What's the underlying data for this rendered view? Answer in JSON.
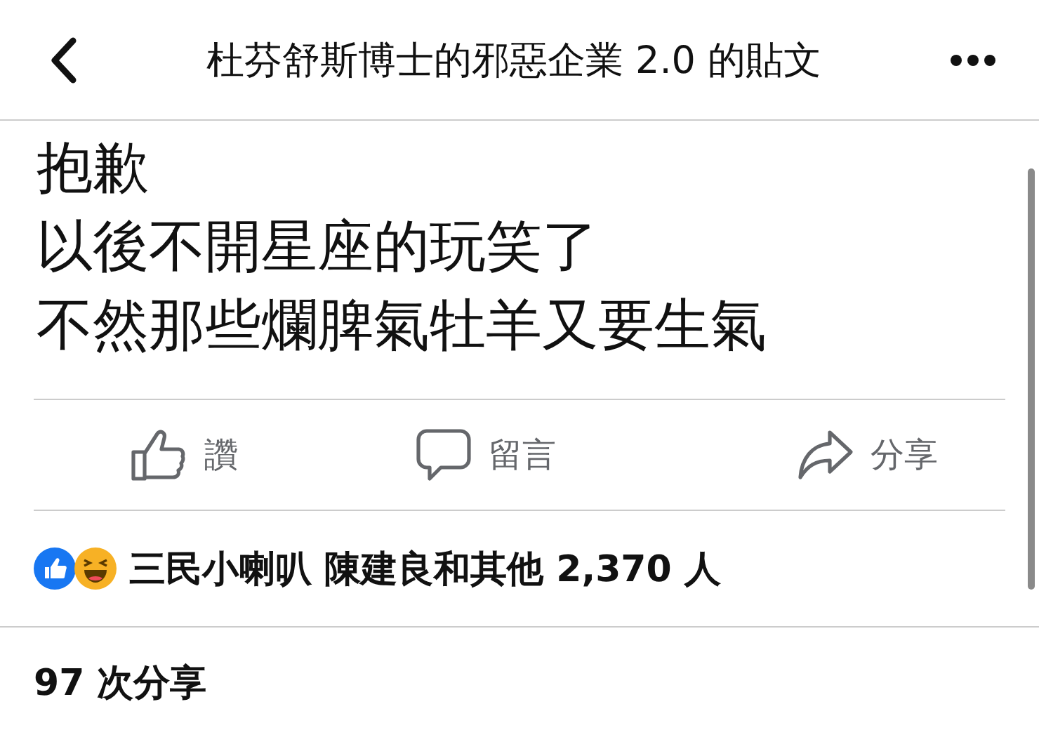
{
  "header": {
    "title": "杜芬舒斯博士的邪惡企業 2.0 的貼文"
  },
  "post": {
    "lines": [
      "抱歉",
      "以後不開星座的玩笑了",
      "不然那些爛脾氣牡羊又要生氣"
    ]
  },
  "actions": [
    {
      "kind": "like",
      "label": "讚"
    },
    {
      "kind": "comment",
      "label": "留言"
    },
    {
      "kind": "share",
      "label": "分享"
    }
  ],
  "reactions": {
    "icons": [
      {
        "kind": "like"
      },
      {
        "kind": "haha"
      }
    ],
    "summary": "三民小喇叭 陳建良和其他 2,370 人"
  },
  "shares": "97 次分享"
}
